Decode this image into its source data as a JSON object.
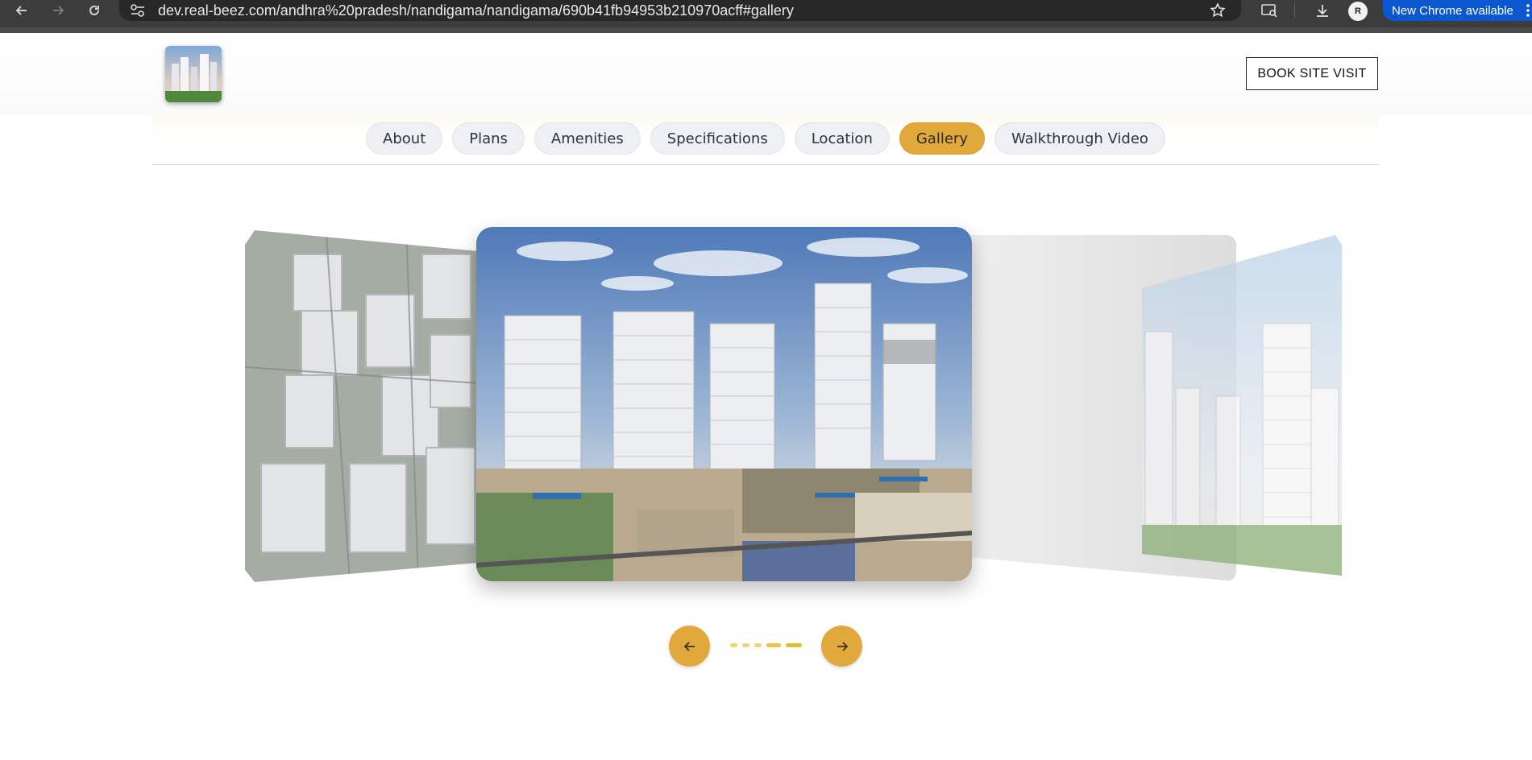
{
  "browser": {
    "url": "dev.real-beez.com/andhra%20pradesh/nandigama/nandigama/690b41fb94953b210970acff#gallery",
    "new_chrome_label": "New Chrome available",
    "avatar_initials": "R"
  },
  "header": {
    "book_site_visit": "BOOK SITE VISIT"
  },
  "tabs": [
    {
      "label": "About",
      "active": false
    },
    {
      "label": "Plans",
      "active": false
    },
    {
      "label": "Amenities",
      "active": false
    },
    {
      "label": "Specifications",
      "active": false
    },
    {
      "label": "Location",
      "active": false
    },
    {
      "label": "Gallery",
      "active": true
    },
    {
      "label": "Walkthrough Video",
      "active": false
    }
  ],
  "gallery": {
    "images": [
      {
        "name": "aerial-view-image"
      },
      {
        "name": "towers-construction-image"
      },
      {
        "name": "rendered-towers-image"
      }
    ],
    "active_dot": 4,
    "dot_count": 5
  },
  "colors": {
    "accent": "#e1a93b",
    "chrome_bg": "#3c3c3c",
    "chrome_blue": "#0b57d0",
    "tab_bg": "#eef0f3",
    "dot_inactive": "#f2d37a",
    "dot_active": "#e8b838"
  },
  "icons": {
    "back": "arrow-left-icon",
    "forward": "arrow-right-icon",
    "reload": "reload-icon",
    "site_info": "tune-icon",
    "bookmark": "star-icon",
    "lens": "lens-icon",
    "download": "download-icon",
    "menu": "kebab-icon",
    "prev": "arrow-left-icon",
    "next": "arrow-right-icon"
  }
}
